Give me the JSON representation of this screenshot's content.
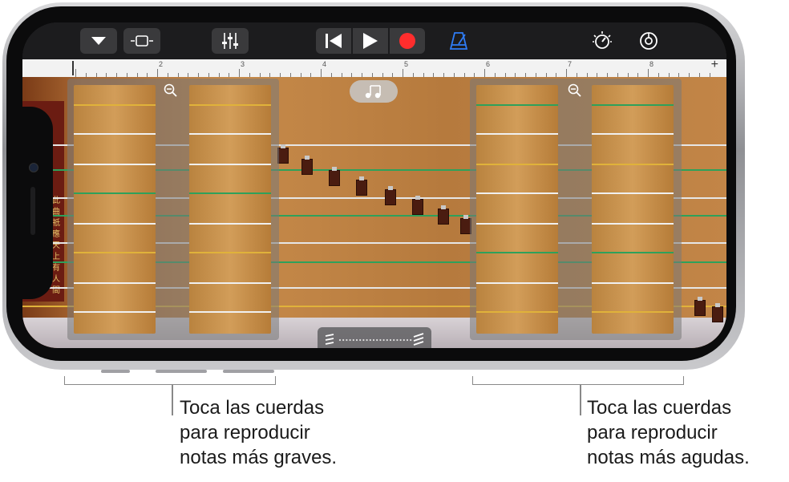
{
  "toolbar": {
    "icons": [
      "chevron-down-icon",
      "view-toggle-icon",
      "mixer-icon",
      "rewind-icon",
      "play-icon",
      "record-icon",
      "metronome-icon",
      "master-volume-icon",
      "settings-icon"
    ],
    "record_color": "#ff2d2d",
    "metronome_color": "#2f7cf6"
  },
  "ruler": {
    "marks": [
      "2",
      "3",
      "4",
      "5",
      "6",
      "7",
      "8"
    ],
    "add_label": "+"
  },
  "instrument": {
    "side_chars": [
      "此",
      "曲",
      "祇",
      "應",
      "天",
      "上",
      "有",
      "人",
      "間"
    ],
    "string_colors": [
      "#e0b23a",
      "#f4f4f4",
      "#2ea15b",
      "#f4f4f4",
      "#e0b23a"
    ]
  },
  "annotations": {
    "left": "Toca las cuerdas\npara reproducir\nnotas más graves.",
    "right": "Toca las cuerdas\npara reproducir\nnotas más agudas."
  }
}
